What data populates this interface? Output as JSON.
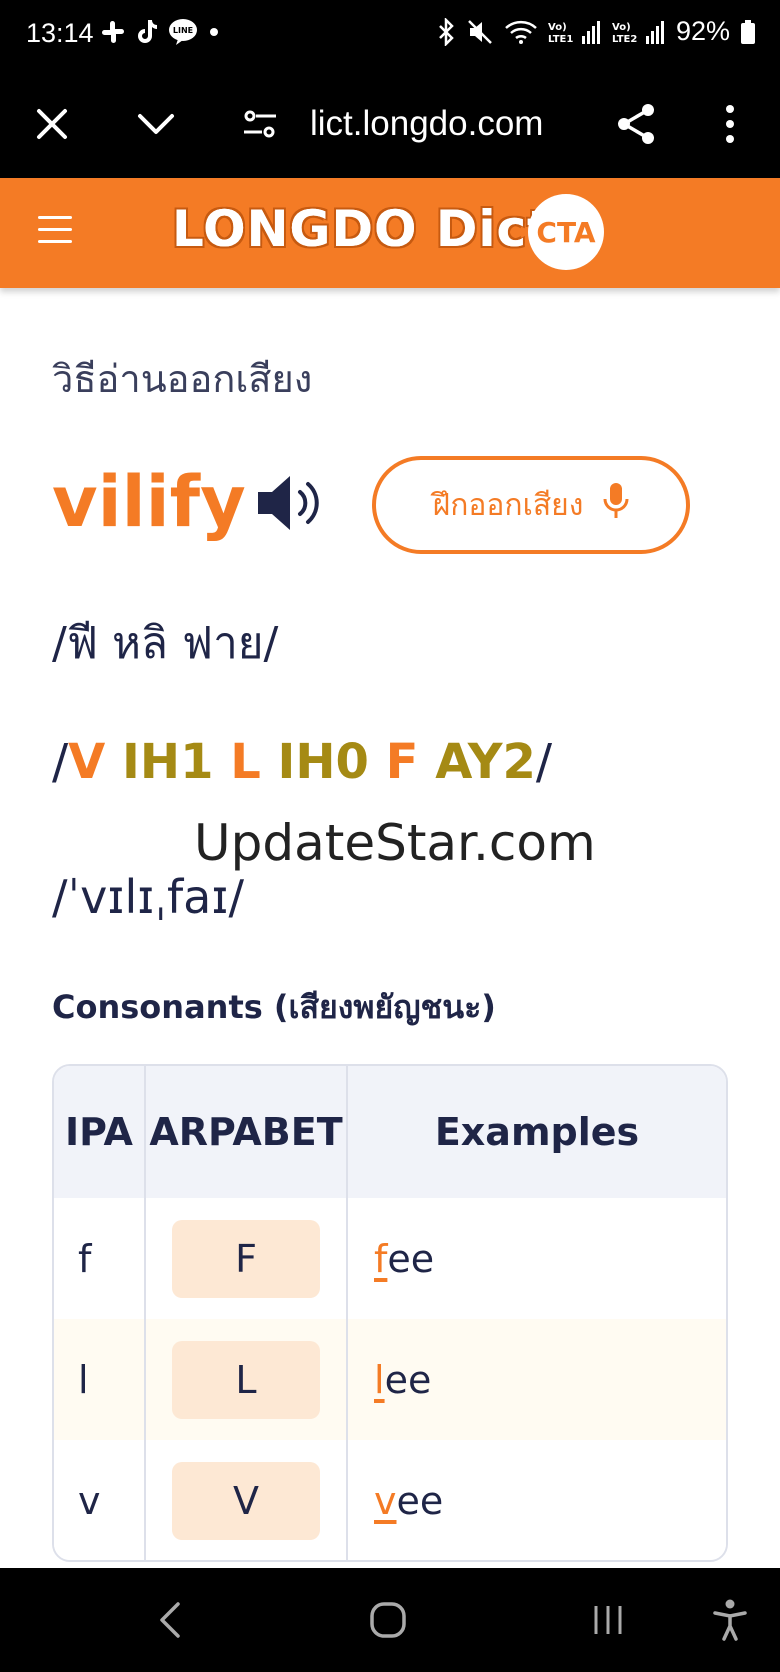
{
  "status_bar": {
    "time": "13:14",
    "battery": "92%",
    "notif_icons": [
      "slack-icon",
      "tiktok-icon",
      "line-icon",
      "dot-icon"
    ],
    "status_icons": [
      "bluetooth-icon",
      "mute-icon",
      "wifi-icon",
      "signal-lte1-icon",
      "signal-lte2-icon",
      "battery-icon"
    ],
    "lte1": "Vo) LTE1",
    "lte2": "Vo) LTE2"
  },
  "browser": {
    "url": "lict.longdo.com",
    "icons": [
      "close-icon",
      "chevron-down-icon",
      "site-settings-icon",
      "share-icon",
      "more-icon"
    ]
  },
  "header": {
    "logo": "LONGDO Dict",
    "badge": "CTA",
    "menu_icon": "hamburger-icon",
    "brand_color": "#f47b25"
  },
  "pronunciation": {
    "title": "วิธีอ่านออกเสียง",
    "word": "vilify",
    "practice_button": "ฝึกออกเสียง",
    "thai": "/ฟี หลิ ฟาย/",
    "arpabet": [
      {
        "text": "V",
        "kind": "cons"
      },
      {
        "text": "IH1",
        "kind": "vow"
      },
      {
        "text": "L",
        "kind": "cons"
      },
      {
        "text": "IH0",
        "kind": "vow"
      },
      {
        "text": "F",
        "kind": "cons"
      },
      {
        "text": "AY2",
        "kind": "vow"
      }
    ],
    "ipa": "/ˈvɪlɪˌfaɪ/",
    "watermark": "UpdateStar.com"
  },
  "consonants": {
    "title": "Consonants (เสียงพยัญชนะ)",
    "headers": [
      "IPA",
      "ARPABET",
      "Examples"
    ],
    "rows": [
      {
        "ipa": "f",
        "arpabet": "F",
        "ex_hl": "f",
        "ex_rest": "ee"
      },
      {
        "ipa": "l",
        "arpabet": "L",
        "ex_hl": "l",
        "ex_rest": "ee"
      },
      {
        "ipa": "v",
        "arpabet": "V",
        "ex_hl": "v",
        "ex_rest": "ee"
      }
    ]
  },
  "nav_bar": {
    "icons": [
      "back-icon",
      "home-icon",
      "recents-icon",
      "accessibility-icon"
    ]
  }
}
